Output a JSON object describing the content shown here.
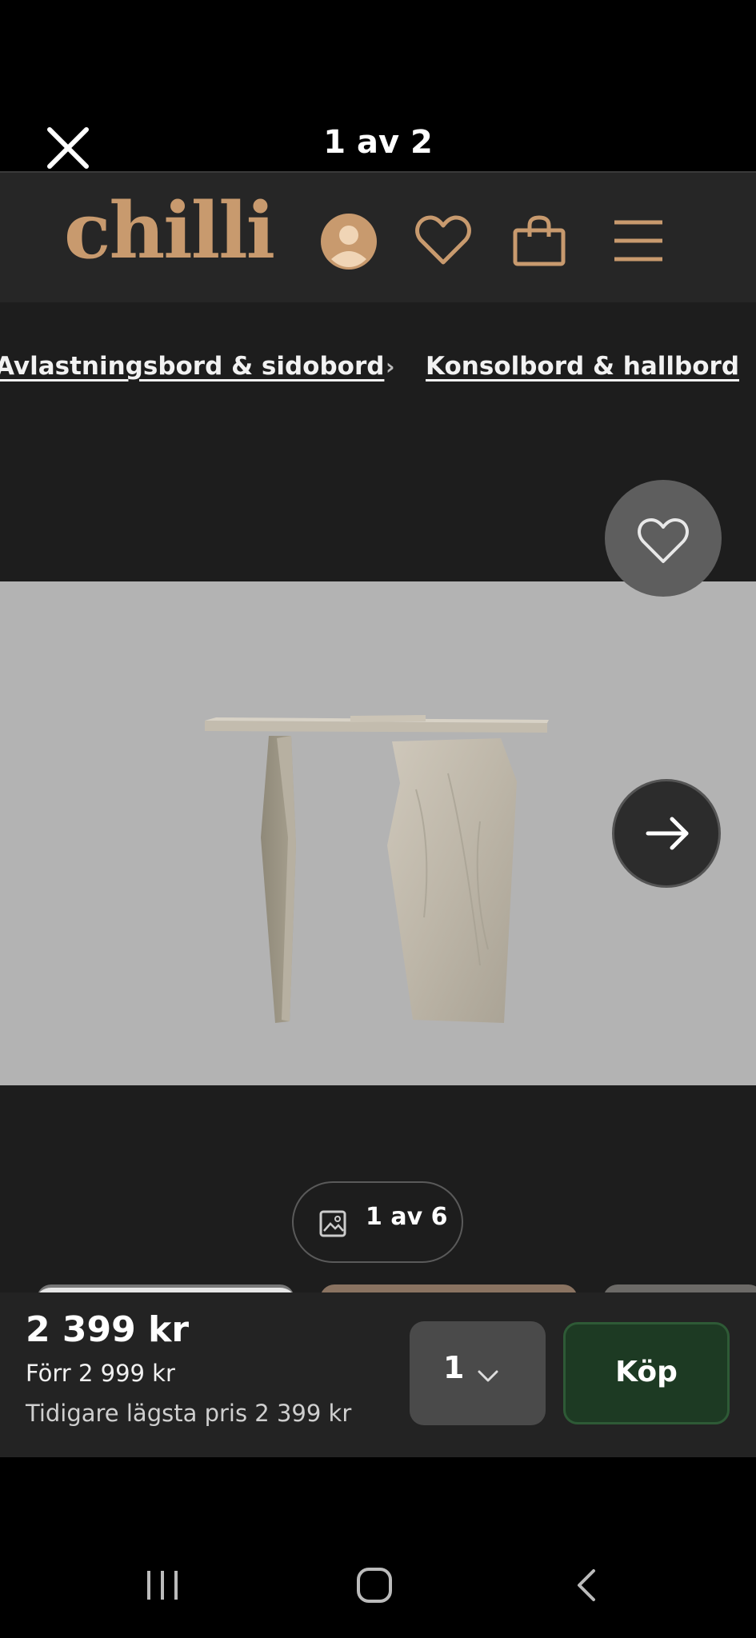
{
  "viewer": {
    "title": "1 av 2"
  },
  "header": {
    "logo": "chilli",
    "icons": [
      "account-icon",
      "heart-icon",
      "bag-icon",
      "menu-icon"
    ],
    "brand_color": "#c89a6e"
  },
  "breadcrumb": {
    "items": [
      "Avlastningsbord & sidobord",
      "Konsolbord & hallbord"
    ],
    "separator": "›"
  },
  "gallery": {
    "counter": "1 av 6"
  },
  "purchase": {
    "price": "2 399 kr",
    "before": "Förr 2 999 kr",
    "lowest": "Tidigare lägsta pris 2 399 kr",
    "quantity": "1",
    "buy_label": "Köp"
  }
}
